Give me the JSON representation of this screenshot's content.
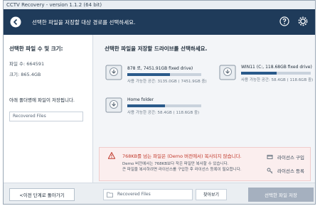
{
  "window": {
    "title": "CCTV Recovery - version 1.1.2 (64 bit)"
  },
  "header": {
    "title": "선택한 파일을 저장할 대상 경로를 선택하세요."
  },
  "left": {
    "title": "선택한 파일 수 및 크기:",
    "file_count": "파일 수: 664591",
    "size": "크기: 865.4GB",
    "folder_label": "아래 폴더명에 파일이 저장됩니다.",
    "folder_value": "Recovered Files"
  },
  "main": {
    "title": "선택한 파일을 저장할 드라이브를 선택하세요.",
    "drives": [
      {
        "name": "878 로, 7451.91GB fixed drive)",
        "space": "사용 가능한 공간: 3135.0GB ( 7451.9GB 중)",
        "used_fraction": 0.58
      },
      {
        "name": "WIN11 (C:, 118.68GB fixed drive)",
        "space": "사용 가능한 공간: 58.4GB ( 118.6GB 중)",
        "used_fraction": 0.51
      },
      {
        "name": "Home folder",
        "space": "사용 가능한 공간: 58.4GB ( 118.6GB 중)",
        "used_fraction": 0.51
      }
    ]
  },
  "warning": {
    "title": "768KB를 넘는 파일은 (Demo 버전에서) 복사되지 않습니다.",
    "line1": "Demo 버전에서는 768KB보다 작은 파일만 복사할 수 있습니다.",
    "line2": "큰 파일을 복사하려면 라이선스를 구입한 후 라이선스 등록이 필요합니다.",
    "buy_license": "라이선스 구입",
    "register_license": "라이선스 등록"
  },
  "footer": {
    "prev_label": "<이전 단계로 돌아가기",
    "path_value": "Recovered Files",
    "browse_label": "찾아보기",
    "save_label": "선택한 파일 저장"
  },
  "colors": {
    "header_bg": "#1f3b5a",
    "warning_text": "#c0392b",
    "save_button": "#a5b0bf"
  }
}
